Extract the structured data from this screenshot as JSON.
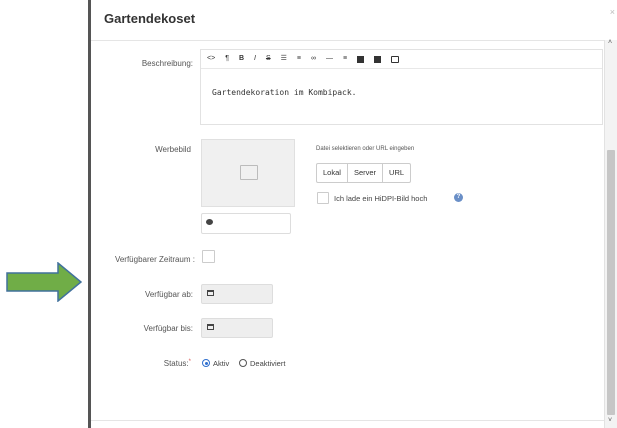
{
  "dialog": {
    "title": "Gartendekoset",
    "close_icon": "close-icon"
  },
  "description": {
    "label": "Beschreibung:",
    "toolbar_icons": [
      "code-icon",
      "paragraph-icon",
      "bold-icon",
      "italic-icon",
      "strikethrough-icon",
      "unordered-list-icon",
      "ordered-list-icon",
      "link-icon",
      "horizontal-rule-icon",
      "align-icon",
      "image-icon",
      "gallery-icon",
      "video-icon"
    ],
    "toolbar_glyphs": [
      "<>",
      "¶",
      "B",
      "I",
      "S",
      "☰",
      "≡",
      "∞",
      "—",
      "≡"
    ],
    "text": "Gartendekoration im Kombipack."
  },
  "image": {
    "label": "Werbebild",
    "select_hint": "Datei selektieren oder URL eingeben",
    "buttons": [
      "Lokal",
      "Server",
      "URL"
    ],
    "hidpi_label": "Ich lade ein HiDPI-Bild hoch",
    "help_glyph": "?"
  },
  "availability": {
    "period_label": "Verfügbarer Zeitraum :",
    "from_label": "Verfügbar ab:",
    "to_label": "Verfügbar bis:"
  },
  "status": {
    "label": "Status:",
    "required_mark": "*",
    "options": [
      "Aktiv",
      "Deaktiviert"
    ],
    "selected": "Aktiv"
  },
  "scrollbar": {
    "up_glyph": "˄",
    "down_glyph": "˅"
  },
  "colors": {
    "arrow_fill": "#70ad47",
    "arrow_stroke": "#41719c",
    "accent": "#2f6fcf",
    "required": "#d9534f"
  }
}
